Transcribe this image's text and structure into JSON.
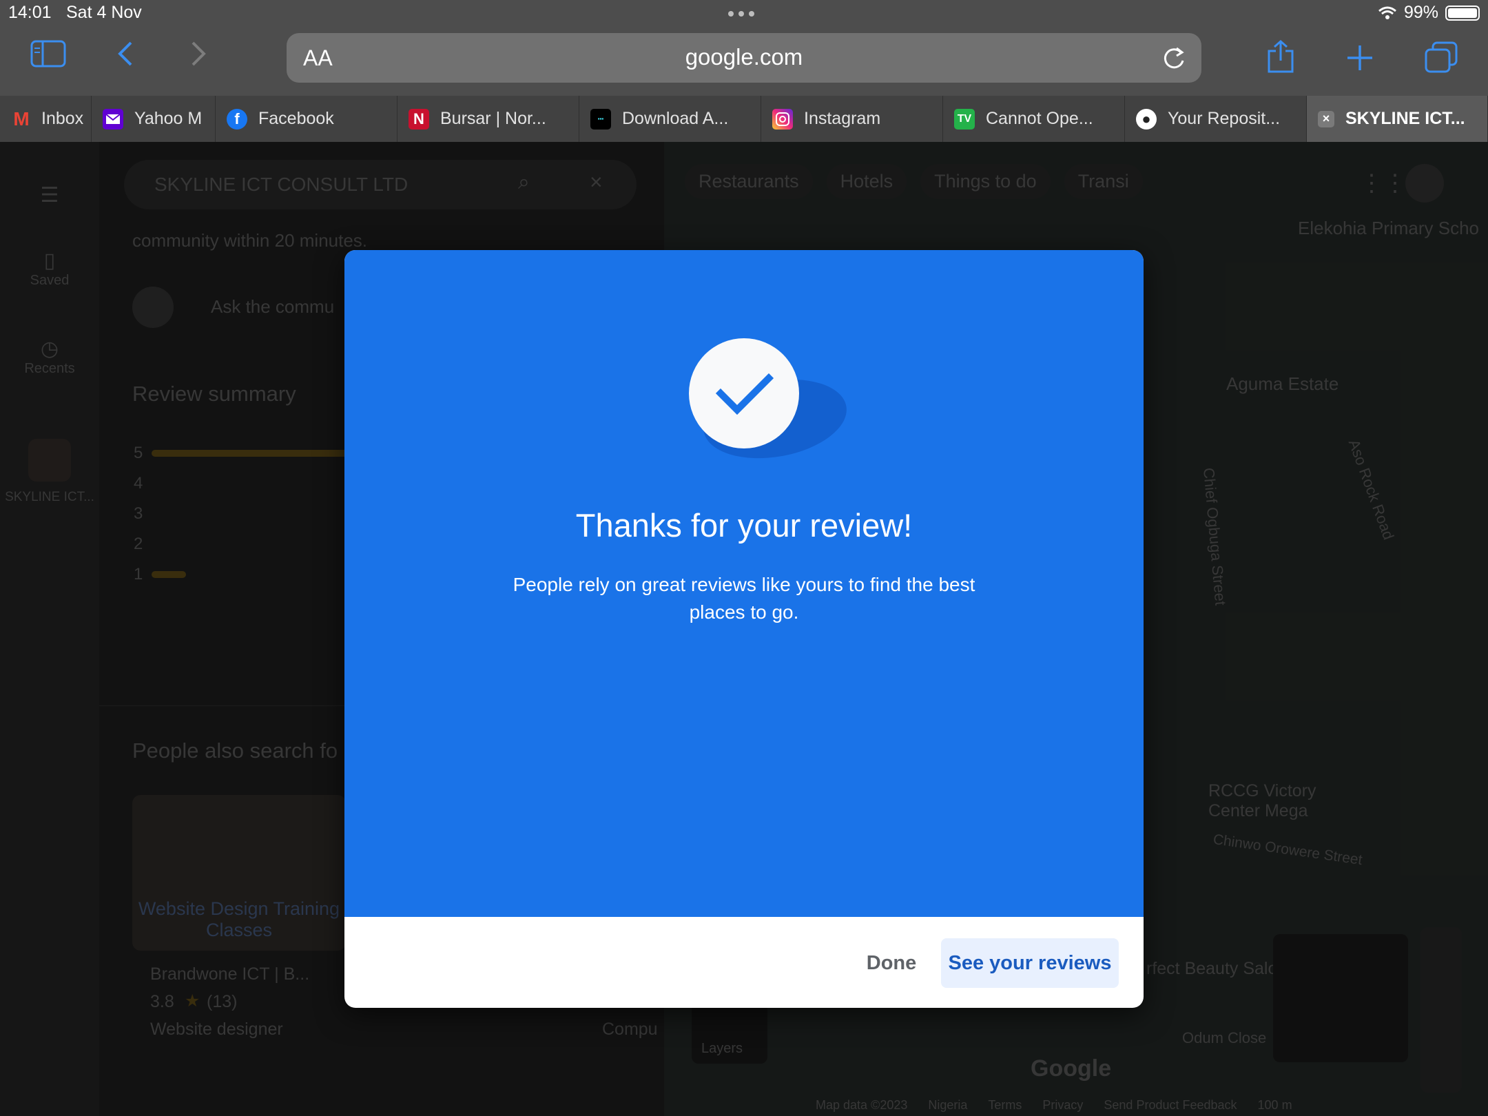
{
  "status_bar": {
    "time": "14:01",
    "date": "Sat 4 Nov",
    "battery": "99%"
  },
  "address_bar": {
    "aa": "AA",
    "url": "google.com"
  },
  "tabs": [
    {
      "label": "Inbox",
      "icon": "gmail-icon"
    },
    {
      "label": "Yahoo M",
      "icon": "yahoo-mail-icon"
    },
    {
      "label": "Facebook",
      "icon": "facebook-icon"
    },
    {
      "label": "Bursar | Nor...",
      "icon": "n-logo-icon"
    },
    {
      "label": "Download A...",
      "icon": "download-site-icon"
    },
    {
      "label": "Instagram",
      "icon": "instagram-icon"
    },
    {
      "label": "Cannot Ope...",
      "icon": "tv-icon"
    },
    {
      "label": "Your Reposit...",
      "icon": "github-icon"
    },
    {
      "label": "SKYLINE ICT...",
      "icon": "close-icon"
    }
  ],
  "background": {
    "search_value": "SKYLINE ICT CONSULT LTD",
    "community_text": "community within 20 minutes.",
    "ask_placeholder": "Ask the commu",
    "rail": {
      "saved": "Saved",
      "recents": "Recents",
      "place": "SKYLINE ICT..."
    },
    "review_summary": "Review summary",
    "ratings": [
      "5",
      "4",
      "3",
      "2",
      "1"
    ],
    "people_also": "People also search fo",
    "card": {
      "overlay": "Website Design Training Classes",
      "name": "Brandwone ICT | B...",
      "rating": "3.8",
      "count": "(13)",
      "type": "Website designer",
      "compu": "Compu"
    },
    "chips": [
      "Restaurants",
      "Hotels",
      "Things to do",
      "Transi"
    ],
    "map_labels": [
      "Elekohia Primary Scho",
      "Aguma Estate",
      "Aso Rock Road",
      "Chief Ogbuga Street",
      "RCCG Victory Center Mega",
      "Chinwo Orowere Street",
      "rfect Beauty Saloon",
      "Odum Close",
      "Google",
      "Layers",
      "Map data ©2023",
      "Nigeria",
      "Terms",
      "Privacy",
      "Send Product Feedback",
      "100 m"
    ]
  },
  "dialog": {
    "title": "Thanks for your review!",
    "body": "People rely on great reviews like yours to find the best places to go.",
    "done": "Done",
    "see_reviews": "See your reviews"
  },
  "colors": {
    "accent": "#1a73e8",
    "button_bg": "#e8f0fe",
    "button_text": "#1a5bbf",
    "chrome": "#4d4d4d"
  }
}
